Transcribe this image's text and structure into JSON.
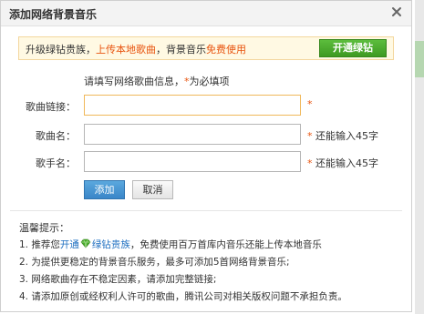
{
  "dialog": {
    "title": "添加网络背景音乐"
  },
  "promo": {
    "prefix": "升级绿钻贵族，",
    "upload_link": "上传本地歌曲",
    "middle": "，背景音乐",
    "free_use": "免费使用",
    "button_label": "开通绿钻"
  },
  "form": {
    "hint_text": "请填写网络歌曲信息，",
    "hint_star": "*",
    "hint_required": "为必填项",
    "fields": [
      {
        "label": "歌曲链接：",
        "value": "",
        "star": "*",
        "note": ""
      },
      {
        "label": "歌曲名：",
        "value": "",
        "star": "*",
        "note": "还能输入45字"
      },
      {
        "label": "歌手名：",
        "value": "",
        "star": "*",
        "note": "还能输入45字"
      }
    ],
    "add_label": "添加",
    "cancel_label": "取消"
  },
  "tips": {
    "title": "温馨提示：",
    "items": [
      {
        "prefix": "1. 推荐您",
        "link1": "开通",
        "link2": "绿钻贵族",
        "suffix": "，免费使用百万首库内音乐还能上传本地音乐"
      },
      {
        "text": "2. 为提供更稳定的背景音乐服务，最多可添加5首网络背景音乐;"
      },
      {
        "text": "3. 网络歌曲存在不稳定因素，请添加完整链接;"
      },
      {
        "text": "4. 请添加原创或经权利人许可的歌曲，腾讯公司对相关版权问题不承担负责。"
      }
    ]
  },
  "colors": {
    "accent_orange": "#e8540f",
    "link_blue": "#1e6fc0",
    "green": "#4aad2c",
    "button_blue": "#3a86c8"
  },
  "icons": {
    "close": "close-icon",
    "diamond": "green-diamond-icon"
  }
}
